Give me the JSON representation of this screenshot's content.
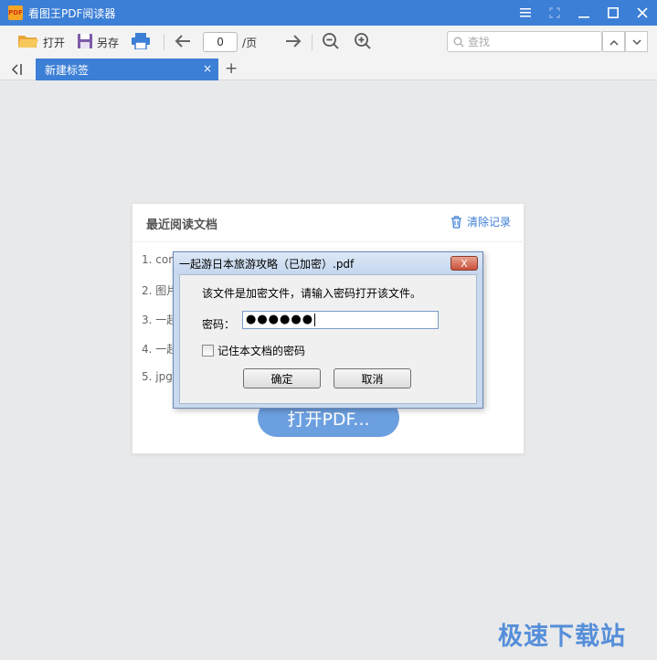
{
  "window": {
    "app_logo_text": "PDF",
    "title": "看图王PDF阅读器",
    "controls": [
      "menu-icon",
      "restore-dim-icon",
      "minimize-icon",
      "maximize-icon",
      "close-icon"
    ]
  },
  "toolbar": {
    "open_label": "打开",
    "save_as_label": "另存",
    "page_input_value": "0",
    "page_suffix": "/页",
    "search_placeholder": "查找",
    "icons": [
      "folder-icon",
      "save-icon",
      "print-icon",
      "prev-page-icon",
      "next-page-icon",
      "zoom-out-icon",
      "zoom-in-icon",
      "search-icon",
      "chevron-up-icon",
      "chevron-down-icon"
    ]
  },
  "tabs": {
    "active_label": "新建标签",
    "close_glyph": "×",
    "add_glyph": "+",
    "collapse_glyph": "<|"
  },
  "recent": {
    "title": "最近阅读文档",
    "clear_label": "清除记录",
    "items": [
      "1. com",
      "2. 图片",
      "3. 一起",
      "4. 一起",
      "5. jpgt"
    ],
    "open_button_label": "打开PDF..."
  },
  "dialog": {
    "title": "一起游日本旅游攻略（已加密）.pdf",
    "close_glyph": "X",
    "message": "该文件是加密文件，请输入密码打开该文件。",
    "password_label": "密码：",
    "password_value": "●●●●●●",
    "remember_label": "记住本文档的密码",
    "remember_checked": false,
    "ok_label": "确定",
    "cancel_label": "取消"
  },
  "watermark": "极速下载站",
  "colors": {
    "accent": "#3c7fd6",
    "background": "#e8e9eb",
    "dialog_frame": "#c9d9ee"
  }
}
